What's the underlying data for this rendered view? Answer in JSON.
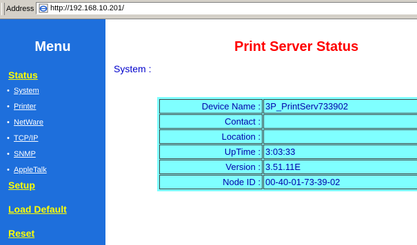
{
  "address_bar": {
    "label": "Address",
    "url": "http://192.168.10.201/"
  },
  "menu": {
    "title": "Menu",
    "status_label": "Status",
    "status_items": [
      "System",
      "Printer",
      "NetWare",
      "TCP/IP",
      "SNMP",
      "AppleTalk"
    ],
    "setup_label": "Setup",
    "load_default_label": "Load Default",
    "reset_label": "Reset"
  },
  "main": {
    "title": "Print Server Status",
    "section": "System :",
    "rows": [
      {
        "label": "Device Name :",
        "value": "3P_PrintServ733902"
      },
      {
        "label": "Contact :",
        "value": ""
      },
      {
        "label": "Location :",
        "value": ""
      },
      {
        "label": "UpTime :",
        "value": "3:03:33"
      },
      {
        "label": "Version :",
        "value": "3.51.11E"
      },
      {
        "label": "Node ID :",
        "value": "00-40-01-73-39-02"
      }
    ]
  },
  "colors": {
    "menu_bg": "#1e6fdc",
    "menu_link": "#ffff00",
    "title_red": "#ff0000",
    "table_bg": "#7fffff",
    "text_blue": "#0000aa"
  },
  "icons": {
    "address_icon": "ie-page-icon"
  }
}
